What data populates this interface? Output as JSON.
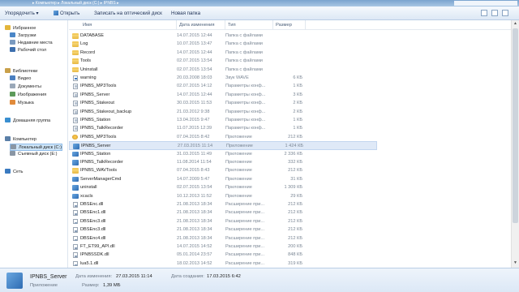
{
  "window": {
    "breadcrumb": "▸ Компьютер ▸ Локальный диск (C:) ▸ IPNBS ▸"
  },
  "toolbar": {
    "organize": "Упорядочить ▾",
    "open": "Открыть",
    "burn": "Записать на оптический диск",
    "new_folder": "Новая папка"
  },
  "nav": {
    "items": [
      {
        "label": "Избранное",
        "icon": "star-icon",
        "color": "#e3b53a"
      },
      {
        "label": "Загрузки",
        "icon": "downloads-icon",
        "color": "#4a86c7"
      },
      {
        "label": "Недавние места",
        "icon": "recent-places-icon",
        "color": "#7a9ac0"
      },
      {
        "label": "Рабочий стол",
        "icon": "desktop-icon",
        "color": "#3d6fae"
      },
      {
        "label": "Библиотеки",
        "icon": "library-icon",
        "color": "#c9a04a"
      },
      {
        "label": "Видео",
        "icon": "video-icon",
        "color": "#4a7fc0"
      },
      {
        "label": "Документы",
        "icon": "documents-icon",
        "color": "#9aa8b8"
      },
      {
        "label": "Изображения",
        "icon": "pictures-icon",
        "color": "#5d9a5a"
      },
      {
        "label": "Музыка",
        "icon": "music-icon",
        "color": "#e08a3a"
      },
      {
        "label": "Домашняя группа",
        "icon": "homegroup-icon",
        "color": "#3a8fd0"
      },
      {
        "label": "Компьютер",
        "icon": "computer-icon",
        "color": "#5b7fa8"
      },
      {
        "label": "Локальный диск (C:)",
        "icon": "drive-icon",
        "color": "#8a96a4"
      },
      {
        "label": "Съемный диск (E:)",
        "icon": "removable-drive-icon",
        "color": "#8a96a4"
      },
      {
        "label": "Сеть",
        "icon": "network-icon",
        "color": "#3a7ac0"
      }
    ]
  },
  "columns": {
    "name": "Имя",
    "date": "Дата изменения",
    "type": "Тип",
    "size": "Размер"
  },
  "files": [
    {
      "name": "DATABASE",
      "date": "14.07.2015 12:44",
      "type": "Папка с файлами",
      "size": "",
      "icon": "folder-icon"
    },
    {
      "name": "Log",
      "date": "10.07.2015 13:47",
      "type": "Папка с файлами",
      "size": "",
      "icon": "folder-icon"
    },
    {
      "name": "Record",
      "date": "14.07.2015 12:44",
      "type": "Папка с файлами",
      "size": "",
      "icon": "folder-icon"
    },
    {
      "name": "Tools",
      "date": "02.07.2015 13:54",
      "type": "Папка с файлами",
      "size": "",
      "icon": "folder-icon"
    },
    {
      "name": "Uninstall",
      "date": "02.07.2015 13:54",
      "type": "Папка с файлами",
      "size": "",
      "icon": "folder-icon"
    },
    {
      "name": "warning",
      "date": "20.03.2008 18:03",
      "type": "Звук WAVE",
      "size": "6 КБ",
      "icon": "audio-file-icon"
    },
    {
      "name": "IPNBS_MP3Tools",
      "date": "02.07.2015 14:12",
      "type": "Параметры конф...",
      "size": "1 КБ",
      "icon": "config-file-icon"
    },
    {
      "name": "IPNBS_Server",
      "date": "14.07.2015 12:44",
      "type": "Параметры конф...",
      "size": "3 КБ",
      "icon": "config-file-icon"
    },
    {
      "name": "IPNBS_Stakeout",
      "date": "30.03.2015 11:53",
      "type": "Параметры конф...",
      "size": "2 КБ",
      "icon": "config-file-icon"
    },
    {
      "name": "IPNBS_Stakeout_backup",
      "date": "21.03.2012 9:38",
      "type": "Параметры конф...",
      "size": "2 КБ",
      "icon": "config-file-icon"
    },
    {
      "name": "IPNBS_Station",
      "date": "13.04.2015 9:47",
      "type": "Параметры конф...",
      "size": "1 КБ",
      "icon": "config-file-icon"
    },
    {
      "name": "IPNBS_TalkRecorder",
      "date": "11.07.2015 12:39",
      "type": "Параметры конф...",
      "size": "1 КБ",
      "icon": "config-file-icon"
    },
    {
      "name": "IPNBS_MP3Tools",
      "date": "07.04.2015 8:42",
      "type": "Приложение",
      "size": "212 КБ",
      "icon": "app-round-icon"
    },
    {
      "name": "IPNBS_Server",
      "date": "27.03.2015 11:14",
      "type": "Приложение",
      "size": "1 424 КБ",
      "icon": "app-icon",
      "selected": true
    },
    {
      "name": "IPNBS_Station",
      "date": "31.03.2015 11:49",
      "type": "Приложение",
      "size": "2 336 КБ",
      "icon": "app-icon"
    },
    {
      "name": "IPNBS_TalkRecorder",
      "date": "11.08.2014 11:54",
      "type": "Приложение",
      "size": "332 КБ",
      "icon": "app-icon"
    },
    {
      "name": "IPNBS_WAVTools",
      "date": "07.04.2015 8:43",
      "type": "Приложение",
      "size": "212 КБ",
      "icon": "folder-icon"
    },
    {
      "name": "ServerManagerCmd",
      "date": "14.07.2009 5:47",
      "type": "Приложение",
      "size": "31 КБ",
      "icon": "app-icon"
    },
    {
      "name": "uninstall",
      "date": "02.07.2015 13:54",
      "type": "Приложение",
      "size": "1 309 КБ",
      "icon": "app-icon"
    },
    {
      "name": "xcacls",
      "date": "10.12.2013 11:52",
      "type": "Приложение",
      "size": "29 КБ",
      "icon": "app-icon"
    },
    {
      "name": "DBSEnc.dll",
      "date": "21.08.2013 18:34",
      "type": "Расширение при...",
      "size": "212 КБ",
      "icon": "dll-icon"
    },
    {
      "name": "DBSEnc1.dll",
      "date": "21.08.2013 18:34",
      "type": "Расширение при...",
      "size": "212 КБ",
      "icon": "dll-icon"
    },
    {
      "name": "DBSEnc3.dll",
      "date": "21.08.2013 18:34",
      "type": "Расширение при...",
      "size": "212 КБ",
      "icon": "dll-icon"
    },
    {
      "name": "DBSEnc3.dll",
      "date": "21.08.2013 18:34",
      "type": "Расширение при...",
      "size": "212 КБ",
      "icon": "dll-icon"
    },
    {
      "name": "DBSEnc4.dll",
      "date": "21.08.2013 18:34",
      "type": "Расширение при...",
      "size": "212 КБ",
      "icon": "dll-icon"
    },
    {
      "name": "FT_ET99_API.dll",
      "date": "14.07.2015 14:52",
      "type": "Расширение при...",
      "size": "200 КБ",
      "icon": "dll-icon"
    },
    {
      "name": "IPNBSSDK.dll",
      "date": "05.01.2014 23:57",
      "type": "Расширение при...",
      "size": "848 КБ",
      "icon": "dll-icon"
    },
    {
      "name": "lua5.1.dll",
      "date": "18.02.2013 14:52",
      "type": "Расширение при...",
      "size": "319 КБ",
      "icon": "dll-icon"
    }
  ],
  "details": {
    "name": "IPNBS_Server",
    "type": "Приложение",
    "modified_label": "Дата изменения:",
    "modified_value": "27.03.2015 11:14",
    "created_label": "Дата создания:",
    "created_value": "17.03.2015 6:42",
    "size_label": "Размер:",
    "size_value": "1,39 МБ"
  }
}
